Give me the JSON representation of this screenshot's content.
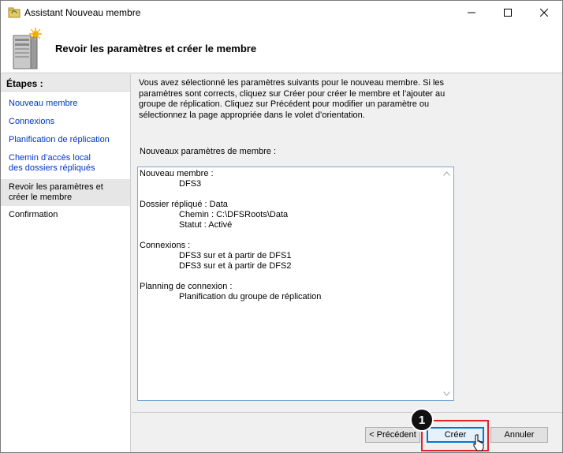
{
  "window": {
    "title": "Assistant Nouveau membre",
    "controls": [
      "minimize",
      "maximize",
      "close"
    ]
  },
  "header": {
    "title": "Revoir les paramètres et créer le membre",
    "icon": "server-wizard-icon"
  },
  "steps": {
    "title": "Étapes :",
    "items": [
      {
        "label": "Nouveau membre",
        "state": "link"
      },
      {
        "label": "Connexions",
        "state": "link"
      },
      {
        "label": "Planification de réplication",
        "state": "link"
      },
      {
        "label": "Chemin d’accès local des dossiers répliqués",
        "state": "link"
      },
      {
        "label": "Revoir les paramètres et créer le membre",
        "state": "current"
      },
      {
        "label": "Confirmation",
        "state": "plain"
      }
    ]
  },
  "main": {
    "intro": "Vous avez sélectionné les paramètres suivants pour le nouveau membre. Si les paramètres sont corrects, cliquez sur Créer pour créer le membre et l’ajouter au groupe de réplication. Cliquez sur Précédent pour modifier un paramètre ou sélectionnez la page appropriée dans le volet d’orientation.",
    "params_label": "Nouveaux paramètres de membre :",
    "summary": {
      "member_heading": "Nouveau membre :",
      "member_value": "DFS3",
      "folder_heading": "Dossier répliqué : Data",
      "folder_path": "Chemin : C:\\DFSRoots\\Data",
      "folder_status": "Statut : Activé",
      "connections_heading": "Connexions :",
      "connection_1": "DFS3 sur et à partir de DFS1",
      "connection_2": "DFS3 sur et à partir de DFS2",
      "schedule_heading": "Planning de connexion :",
      "schedule_value": "Planification du groupe de réplication"
    }
  },
  "footer": {
    "prev_label": "< Précédent",
    "create_label": "Créer",
    "cancel_label": "Annuler",
    "callout_number": "1",
    "highlight_color": "#e0242a"
  }
}
